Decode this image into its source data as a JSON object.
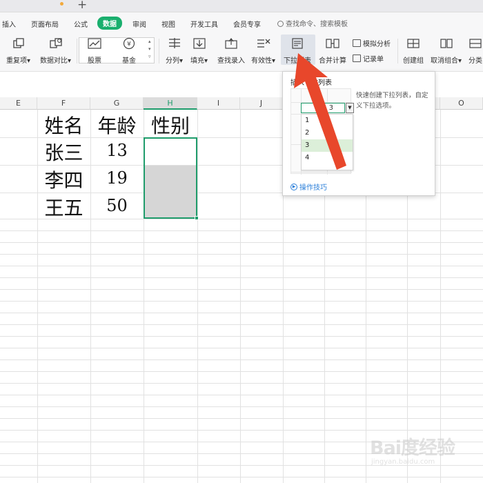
{
  "menubar": {
    "items": [
      "插入",
      "页面布局",
      "公式",
      "数据",
      "审阅",
      "视图",
      "开发工具",
      "会员专享"
    ],
    "active": "数据",
    "search_placeholder": "查找命令、搜索模板"
  },
  "ribbon": {
    "buttons": {
      "dup": "重复项",
      "compare": "数据对比",
      "stock": "股票",
      "fund": "基金",
      "split": "分列",
      "fill": "填充",
      "lookup": "查找录入",
      "validity": "有效性",
      "dropdown": "下拉列表",
      "merge_calc": "合并计算",
      "simulate": "模拟分析",
      "record": "记录单",
      "group": "创建组",
      "ungroup": "取消组合",
      "subtotal": "分类"
    },
    "dropdown_marker": "▾"
  },
  "columns": [
    "E",
    "F",
    "G",
    "H",
    "I",
    "J",
    "O"
  ],
  "selected_column": "H",
  "table": {
    "headers": [
      "姓名",
      "年龄",
      "性别"
    ],
    "rows": [
      {
        "name": "张三",
        "age": "13"
      },
      {
        "name": "李四",
        "age": "19"
      },
      {
        "name": "王五",
        "age": "50"
      }
    ]
  },
  "popup": {
    "title": "插入下拉列表",
    "description": "快速创建下拉列表，自定义下拉选项。",
    "preview_value": "3",
    "options": [
      "1",
      "2",
      "3",
      "4"
    ],
    "selected_option": "3",
    "tips": "操作技巧"
  },
  "watermark": {
    "logo": "Bai度经验",
    "url": "jingyan.baidu.com"
  },
  "colors": {
    "accent_green": "#1aaf6e",
    "selection_green": "#1e9c6b",
    "arrow_red": "#e8472b",
    "link_blue": "#2b7fd9"
  }
}
